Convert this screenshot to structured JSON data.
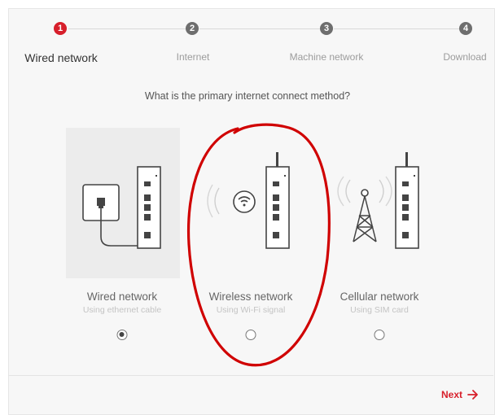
{
  "stepper": {
    "steps": [
      {
        "number": "1",
        "label": "Wired network"
      },
      {
        "number": "2",
        "label": "Internet"
      },
      {
        "number": "3",
        "label": "Machine network"
      },
      {
        "number": "4",
        "label": "Download"
      }
    ],
    "active_step": 1
  },
  "question": "What is the primary internet connect method?",
  "options": [
    {
      "title": "Wired network",
      "subtitle": "Using ethernet cable",
      "icon": "ethernet-wall-socket-icon",
      "selected": true
    },
    {
      "title": "Wireless network",
      "subtitle": "Using Wi-Fi signal",
      "icon": "wifi-icon",
      "selected": false
    },
    {
      "title": "Cellular network",
      "subtitle": "Using SIM card",
      "icon": "cell-tower-icon",
      "selected": false
    }
  ],
  "footer": {
    "next_label": "Next"
  },
  "colors": {
    "accent": "#d71f2b",
    "annotation": "#d00000"
  }
}
